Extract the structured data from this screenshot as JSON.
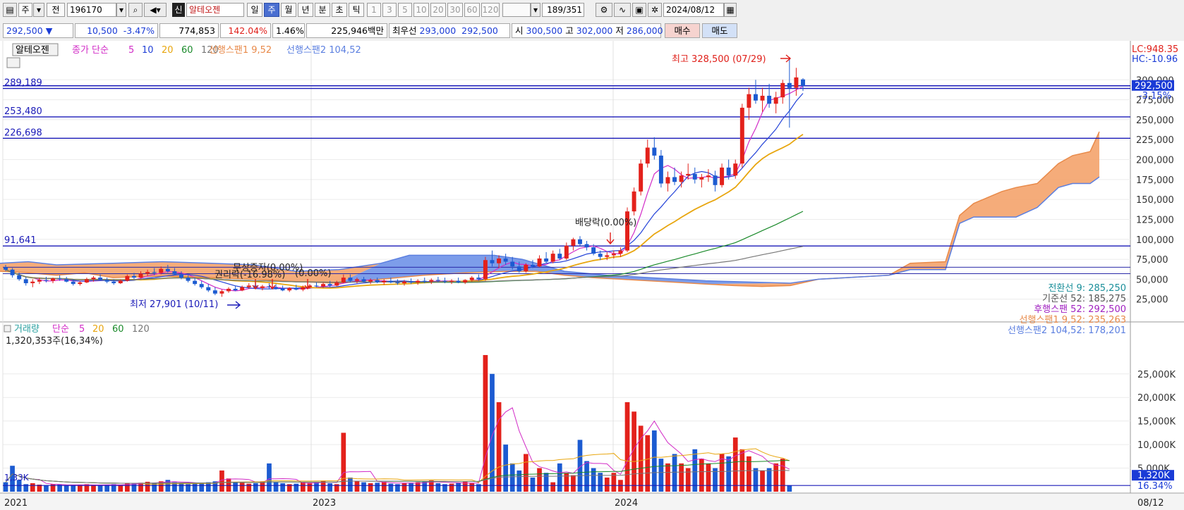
{
  "toolbar": {
    "period_select": "주",
    "prev_button": "전",
    "code": "196170",
    "badge": "신",
    "stock_name": "알테오젠",
    "periods": [
      "일",
      "주",
      "월",
      "년",
      "분",
      "초",
      "틱"
    ],
    "selected_period": "주",
    "intervals": [
      "1",
      "3",
      "5",
      "10",
      "20",
      "30",
      "60",
      "120"
    ],
    "count_current": "189",
    "count_total": "/351",
    "date": "2024/08/12"
  },
  "quote": {
    "price": "292,500",
    "arrow": "▼",
    "change": "10,500",
    "change_pct": "-3.47%",
    "volume": "774,853",
    "vol_ratio": "142.04%",
    "turnover_pct": "1.46%",
    "amount": "225,946백만",
    "best_label": "최우선",
    "best_ask": "293,000",
    "best_bid": "292,500",
    "open_label": "시",
    "open": "300,500",
    "high_label": "고",
    "high": "302,000",
    "low_label": "저",
    "low": "286,000",
    "buy_button": "매수",
    "sell_button": "매도"
  },
  "legend": {
    "stock": "알테오젠",
    "ma_prefix": "종가 단순",
    "ma_periods": [
      {
        "label": "5",
        "color": "#d22cc7"
      },
      {
        "label": "10",
        "color": "#2342d8"
      },
      {
        "label": "20",
        "color": "#e8a60f"
      },
      {
        "label": "60",
        "color": "#1a8a2a"
      },
      {
        "label": "120",
        "color": "#777777"
      }
    ],
    "span1": "선행스팬1 9,52",
    "span2": "선행스팬2 104,52",
    "volume_title": "거래량",
    "volume_ma_prefix": "단순",
    "volume_ma_periods": [
      {
        "label": "5",
        "color": "#d22cc7"
      },
      {
        "label": "20",
        "color": "#e8a60f"
      },
      {
        "label": "60",
        "color": "#1a8a2a"
      },
      {
        "label": "120",
        "color": "#777777"
      }
    ],
    "volume_info": "1,320,353주(16,34%)"
  },
  "annotations": {
    "high_label": "최고 328,500 (07/29)",
    "low_label": "최저 27,901 (10/11)",
    "dividend_label": "배당락(0.00%)",
    "event_label_1": "무상증자(0.00%)",
    "event_label_2": "권리락(-16.98%)",
    "event_label_3": "(0.00%)",
    "lc_label": "LC:948.35",
    "hc_label": "HC:-10.96",
    "vol_small_label": "1,33K"
  },
  "price_lines": [
    {
      "label": "289,189",
      "value": 289189
    },
    {
      "label": "253,480",
      "value": 253480
    },
    {
      "label": "226,698",
      "value": 226698
    },
    {
      "label": "91,641",
      "value": 91641
    }
  ],
  "ichimoku_readout": [
    {
      "label": "전환선 9: 285,250",
      "color": "#1a8f9a"
    },
    {
      "label": "기준선 52: 185,275",
      "color": "#555555"
    },
    {
      "label": "후행스팬 52: 292,500",
      "color": "#a020c0"
    },
    {
      "label": "선행스팬1 9,52: 235,263",
      "color": "#e88a4a"
    },
    {
      "label": "선행스팬2 104,52: 178,201",
      "color": "#5b7fe0"
    }
  ],
  "price_axis": {
    "ticks": [
      "300,000",
      "275,000",
      "250,000",
      "225,000",
      "200,000",
      "175,000",
      "150,000",
      "125,000",
      "100,000",
      "75,000",
      "50,000",
      "25,000"
    ],
    "tick_values": [
      300000,
      275000,
      250000,
      225000,
      200000,
      175000,
      150000,
      125000,
      100000,
      75000,
      50000,
      25000
    ],
    "current_price_box": "292,500",
    "current_pct_box": "-3.15%"
  },
  "volume_axis": {
    "ticks": [
      "25,000K",
      "20,000K",
      "15,000K",
      "10,000K",
      "5,000K"
    ],
    "tick_values": [
      25000,
      20000,
      15000,
      10000,
      5000
    ],
    "current_volume_box": "1,320K",
    "current_pct_box": "16.34%"
  },
  "time_axis": {
    "labels": [
      "2021",
      "2023",
      "2024"
    ],
    "right_label": "08/12"
  },
  "colors": {
    "up": "#e3211b",
    "down": "#1c5bd1",
    "span_up_cloud": "#f4a36b",
    "span_down_cloud": "#6f92e8",
    "level_line": "#1a1ab8"
  },
  "chart_data": {
    "type": "candlestick",
    "title": "알테오젠",
    "xlabel": "",
    "ylabel": "",
    "ylim": [
      0,
      340000
    ],
    "notes": "weekly candles approximated from screenshot; cloud is ichimoku",
    "candles": [
      [
        65000,
        68000,
        60000,
        62000
      ],
      [
        62000,
        64000,
        52000,
        55000
      ],
      [
        55000,
        58000,
        48000,
        50000
      ],
      [
        50000,
        53000,
        42000,
        45000
      ],
      [
        45000,
        50000,
        40000,
        47000
      ],
      [
        47000,
        52000,
        44000,
        49000
      ],
      [
        49000,
        53000,
        46000,
        48000
      ],
      [
        48000,
        52000,
        45000,
        51000
      ],
      [
        51000,
        55000,
        48000,
        50000
      ],
      [
        50000,
        53000,
        46000,
        47000
      ],
      [
        47000,
        50000,
        42000,
        44000
      ],
      [
        44000,
        48000,
        42000,
        46000
      ],
      [
        46000,
        52000,
        45000,
        50000
      ],
      [
        50000,
        54000,
        47000,
        52000
      ],
      [
        52000,
        56000,
        48000,
        49000
      ],
      [
        49000,
        52000,
        45000,
        47000
      ],
      [
        47000,
        50000,
        43000,
        45000
      ],
      [
        45000,
        50000,
        44000,
        48000
      ],
      [
        48000,
        56000,
        47000,
        54000
      ],
      [
        54000,
        58000,
        50000,
        52000
      ],
      [
        52000,
        60000,
        51000,
        57000
      ],
      [
        57000,
        62000,
        54000,
        59000
      ],
      [
        59000,
        64000,
        55000,
        58000
      ],
      [
        58000,
        66000,
        56000,
        63000
      ],
      [
        63000,
        68000,
        58000,
        60000
      ],
      [
        60000,
        64000,
        55000,
        56000
      ],
      [
        56000,
        60000,
        50000,
        52000
      ],
      [
        52000,
        55000,
        46000,
        48000
      ],
      [
        48000,
        52000,
        42000,
        44000
      ],
      [
        44000,
        48000,
        38000,
        40000
      ],
      [
        40000,
        44000,
        34000,
        36000
      ],
      [
        36000,
        40000,
        30000,
        32000
      ],
      [
        32000,
        37000,
        27901,
        35000
      ],
      [
        35000,
        40000,
        33000,
        38000
      ],
      [
        38000,
        42000,
        35000,
        36000
      ],
      [
        36000,
        42000,
        35000,
        40000
      ],
      [
        40000,
        45000,
        38000,
        42000
      ],
      [
        42000,
        46000,
        38000,
        39000
      ],
      [
        39000,
        43000,
        36000,
        41000
      ],
      [
        41000,
        45000,
        38000,
        40000
      ],
      [
        40000,
        44000,
        37000,
        38000
      ],
      [
        38000,
        42000,
        35000,
        36000
      ],
      [
        36000,
        40000,
        34000,
        39000
      ],
      [
        39000,
        43000,
        36000,
        37000
      ],
      [
        37000,
        42000,
        35000,
        40000
      ],
      [
        40000,
        44000,
        38000,
        42000
      ],
      [
        42000,
        46000,
        40000,
        41000
      ],
      [
        41000,
        46000,
        39000,
        44000
      ],
      [
        44000,
        48000,
        40000,
        42000
      ],
      [
        42000,
        48000,
        41000,
        46000
      ],
      [
        46000,
        56000,
        45000,
        52000
      ],
      [
        52000,
        56000,
        46000,
        48000
      ],
      [
        48000,
        52000,
        45000,
        50000
      ],
      [
        50000,
        53000,
        46000,
        47000
      ],
      [
        47000,
        51000,
        44000,
        49000
      ],
      [
        49000,
        52000,
        45000,
        46000
      ],
      [
        46000,
        50000,
        43000,
        48000
      ],
      [
        48000,
        52000,
        45000,
        46000
      ],
      [
        46000,
        50000,
        43000,
        45000
      ],
      [
        45000,
        49000,
        42000,
        47000
      ],
      [
        47000,
        51000,
        44000,
        46000
      ],
      [
        46000,
        50000,
        43000,
        48000
      ],
      [
        48000,
        52000,
        45000,
        47000
      ],
      [
        47000,
        51000,
        44000,
        49000
      ],
      [
        49000,
        53000,
        46000,
        48000
      ],
      [
        48000,
        52000,
        45000,
        47000
      ],
      [
        47000,
        50000,
        44000,
        48000
      ],
      [
        48000,
        52000,
        45000,
        46000
      ],
      [
        46000,
        50000,
        44000,
        49000
      ],
      [
        49000,
        54000,
        47000,
        52000
      ],
      [
        52000,
        56000,
        48000,
        50000
      ],
      [
        50000,
        78000,
        48000,
        74000
      ],
      [
        74000,
        86000,
        66000,
        70000
      ],
      [
        70000,
        80000,
        64000,
        76000
      ],
      [
        76000,
        82000,
        68000,
        72000
      ],
      [
        72000,
        78000,
        62000,
        66000
      ],
      [
        66000,
        72000,
        58000,
        60000
      ],
      [
        60000,
        70000,
        58000,
        68000
      ],
      [
        68000,
        74000,
        64000,
        66000
      ],
      [
        66000,
        80000,
        65000,
        76000
      ],
      [
        76000,
        84000,
        70000,
        72000
      ],
      [
        72000,
        86000,
        70000,
        82000
      ],
      [
        82000,
        88000,
        74000,
        76000
      ],
      [
        76000,
        96000,
        74000,
        92000
      ],
      [
        92000,
        102000,
        86000,
        100000
      ],
      [
        100000,
        104000,
        92000,
        94000
      ],
      [
        94000,
        98000,
        86000,
        90000
      ],
      [
        90000,
        94000,
        80000,
        82000
      ],
      [
        82000,
        86000,
        74000,
        78000
      ],
      [
        78000,
        84000,
        74000,
        80000
      ],
      [
        80000,
        86000,
        76000,
        82000
      ],
      [
        82000,
        90000,
        78000,
        86000
      ],
      [
        86000,
        140000,
        84000,
        135000
      ],
      [
        135000,
        165000,
        130000,
        160000
      ],
      [
        160000,
        200000,
        155000,
        195000
      ],
      [
        195000,
        225000,
        190000,
        215000
      ],
      [
        215000,
        228000,
        200000,
        205000
      ],
      [
        205000,
        212000,
        165000,
        170000
      ],
      [
        170000,
        185000,
        160000,
        178000
      ],
      [
        178000,
        190000,
        168000,
        172000
      ],
      [
        172000,
        185000,
        165000,
        180000
      ],
      [
        180000,
        195000,
        175000,
        182000
      ],
      [
        182000,
        190000,
        170000,
        175000
      ],
      [
        175000,
        182000,
        165000,
        178000
      ],
      [
        178000,
        188000,
        172000,
        180000
      ],
      [
        180000,
        186000,
        160000,
        168000
      ],
      [
        168000,
        195000,
        165000,
        190000
      ],
      [
        190000,
        200000,
        175000,
        180000
      ],
      [
        180000,
        200000,
        176000,
        195000
      ],
      [
        195000,
        270000,
        190000,
        265000
      ],
      [
        265000,
        290000,
        250000,
        282000
      ],
      [
        282000,
        300000,
        270000,
        274000
      ],
      [
        274000,
        290000,
        260000,
        280000
      ],
      [
        280000,
        295000,
        265000,
        270000
      ],
      [
        270000,
        285000,
        258000,
        278000
      ],
      [
        278000,
        300000,
        270000,
        296000
      ],
      [
        296000,
        328500,
        240000,
        290000
      ],
      [
        290000,
        315000,
        280000,
        303000
      ],
      [
        300500,
        302000,
        286000,
        292500
      ]
    ],
    "volume": [
      2.0,
      5.5,
      2.5,
      1.6,
      1.8,
      1.5,
      1.4,
      1.6,
      1.5,
      1.3,
      1.4,
      1.5,
      1.6,
      1.4,
      1.3,
      1.5,
      1.6,
      1.4,
      1.8,
      1.7,
      1.9,
      2.1,
      1.8,
      2.2,
      2.5,
      2.0,
      1.8,
      1.6,
      1.7,
      1.9,
      2.0,
      2.2,
      4.5,
      2.8,
      2.0,
      1.9,
      1.7,
      1.8,
      2.2,
      6.0,
      2.0,
      1.8,
      1.6,
      1.7,
      2.0,
      1.9,
      2.1,
      2.3,
      1.8,
      1.6,
      12.5,
      3.0,
      2.2,
      2.0,
      1.8,
      1.9,
      2.1,
      1.7,
      1.6,
      1.8,
      1.9,
      2.0,
      2.2,
      2.4,
      1.8,
      1.6,
      1.7,
      1.9,
      2.1,
      1.8,
      1.6,
      29.0,
      25.0,
      19.0,
      10.0,
      6.0,
      4.5,
      8.0,
      3.0,
      5.0,
      4.0,
      2.0,
      6.0,
      4.0,
      3.5,
      11.0,
      6.5,
      5.0,
      4.0,
      3.0,
      4.0,
      2.5,
      19.0,
      17.0,
      14.0,
      12.0,
      13.0,
      7.0,
      6.0,
      8.0,
      6.0,
      5.0,
      9.0,
      7.0,
      6.0,
      5.0,
      8.0,
      7.5,
      11.5,
      9.0,
      7.5,
      5.0,
      4.5,
      5.0,
      6.0,
      7.0,
      1.32
    ],
    "span1": [],
    "span2": []
  }
}
